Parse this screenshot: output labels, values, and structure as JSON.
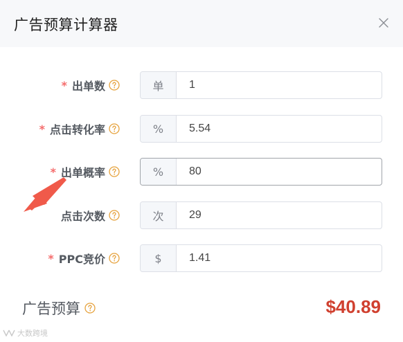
{
  "dialog": {
    "title": "广告预算计算器",
    "close_icon": "close-icon"
  },
  "fields": [
    {
      "label": "出单数",
      "required": "*",
      "unit": "单",
      "value": "1"
    },
    {
      "label": "点击转化率",
      "required": "*",
      "unit": "%",
      "value": "5.54"
    },
    {
      "label": "出单概率",
      "required": "*",
      "unit": "%",
      "value": "80"
    },
    {
      "label": "点击次数",
      "required": "",
      "unit": "次",
      "value": "29"
    },
    {
      "label": "PPC竞价",
      "required": "*",
      "unit": "$",
      "value": "1.41"
    }
  ],
  "result": {
    "label": "广告预算",
    "value": "$40.89"
  },
  "watermark": {
    "text": "大数跨境"
  },
  "colors": {
    "required": "#f56c6c",
    "help_icon": "#e6a23c",
    "result_value": "#d0402f",
    "annotation_arrow": "#f05a4a"
  },
  "icons": {
    "help": "question-circle-icon",
    "annotation": "red-arrow-annotation"
  }
}
